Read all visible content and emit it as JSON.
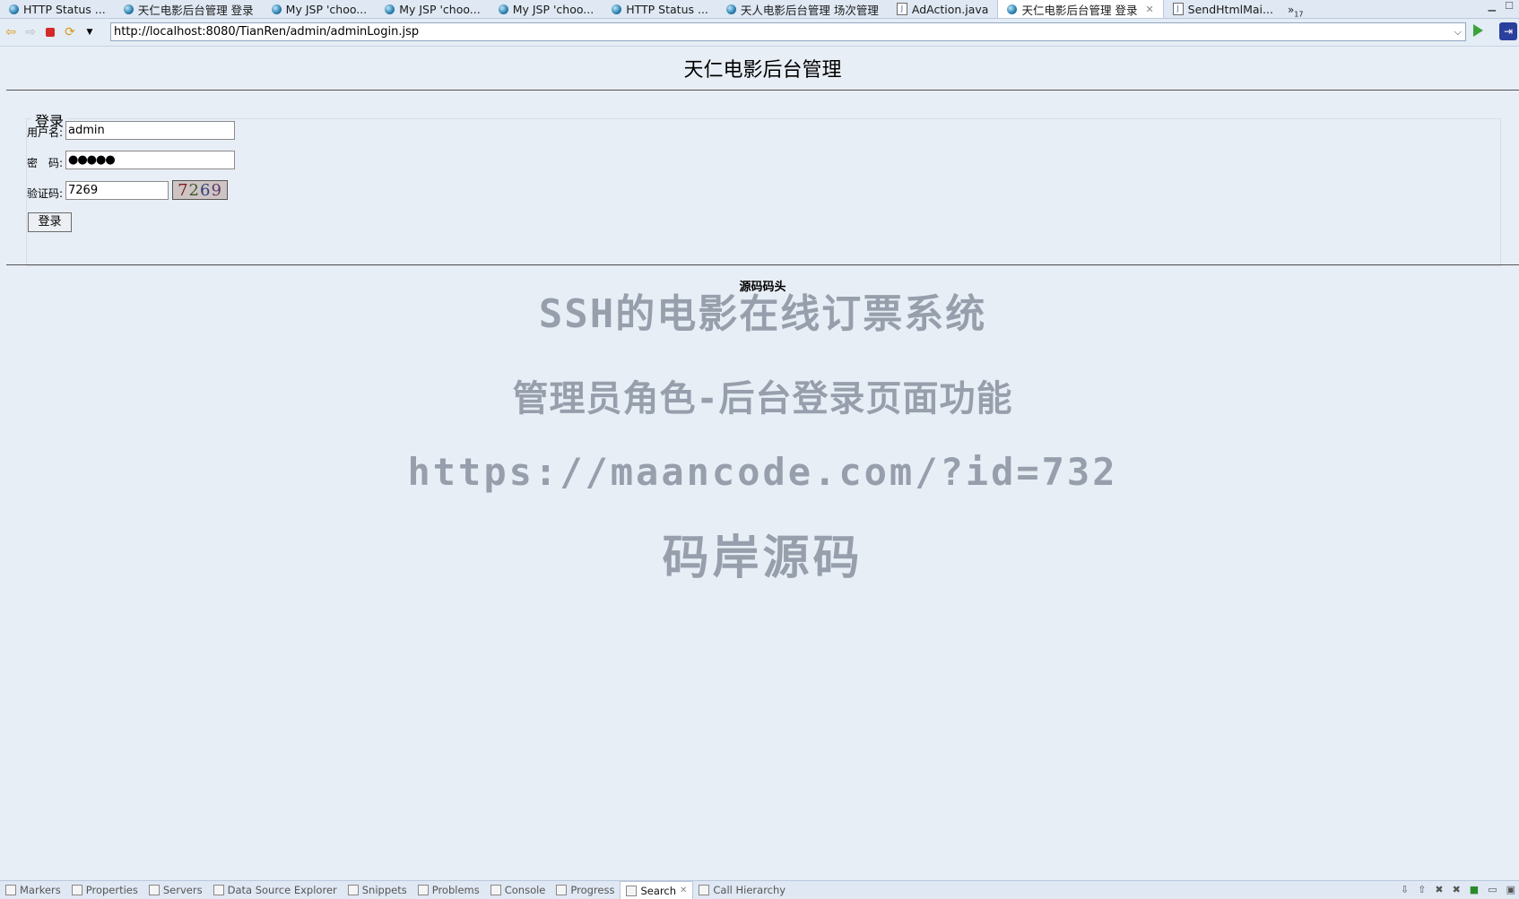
{
  "tabs": [
    {
      "label": "HTTP Status ...",
      "icon": "globe-icon"
    },
    {
      "label": "天仁电影后台管理 登录",
      "icon": "globe-icon"
    },
    {
      "label": "My JSP 'choo...",
      "icon": "globe-icon"
    },
    {
      "label": "My JSP 'choo...",
      "icon": "globe-icon"
    },
    {
      "label": "My JSP 'choo...",
      "icon": "globe-icon"
    },
    {
      "label": "HTTP Status ...",
      "icon": "globe-icon"
    },
    {
      "label": "天人电影后台管理 场次管理",
      "icon": "globe-icon"
    },
    {
      "label": "AdAction.java",
      "icon": "java-file-icon"
    },
    {
      "label": "天仁电影后台管理 登录",
      "icon": "globe-icon",
      "active": true
    },
    {
      "label": "SendHtmlMai...",
      "icon": "java-file-icon"
    }
  ],
  "tab_overflow": {
    "symbol": "»",
    "count": "17"
  },
  "toolbar": {
    "url": "http://localhost:8080/TianRen/admin/adminLogin.jsp"
  },
  "page": {
    "title": "天仁电影后台管理",
    "legend": "登录",
    "username_label": "用户名:",
    "username_value": "admin",
    "password_label": "密　码:",
    "password_value": "●●●●●",
    "captcha_label": "验证码:",
    "captcha_value": "7269",
    "captcha_image_text": [
      "7",
      "2",
      "6",
      "9"
    ],
    "login_button": "登录",
    "footer": "源码码头"
  },
  "watermark": {
    "line1": "SSH的电影在线订票系统",
    "line2": "管理员角色-后台登录页面功能",
    "line3": "https://maancode.com/?id=732",
    "line4": "码岸源码"
  },
  "bottom_views": [
    {
      "label": "Markers"
    },
    {
      "label": "Properties"
    },
    {
      "label": "Servers"
    },
    {
      "label": "Data Source Explorer"
    },
    {
      "label": "Snippets"
    },
    {
      "label": "Problems"
    },
    {
      "label": "Console"
    },
    {
      "label": "Progress"
    },
    {
      "label": "Search",
      "active": true
    },
    {
      "label": "Call Hierarchy"
    }
  ]
}
